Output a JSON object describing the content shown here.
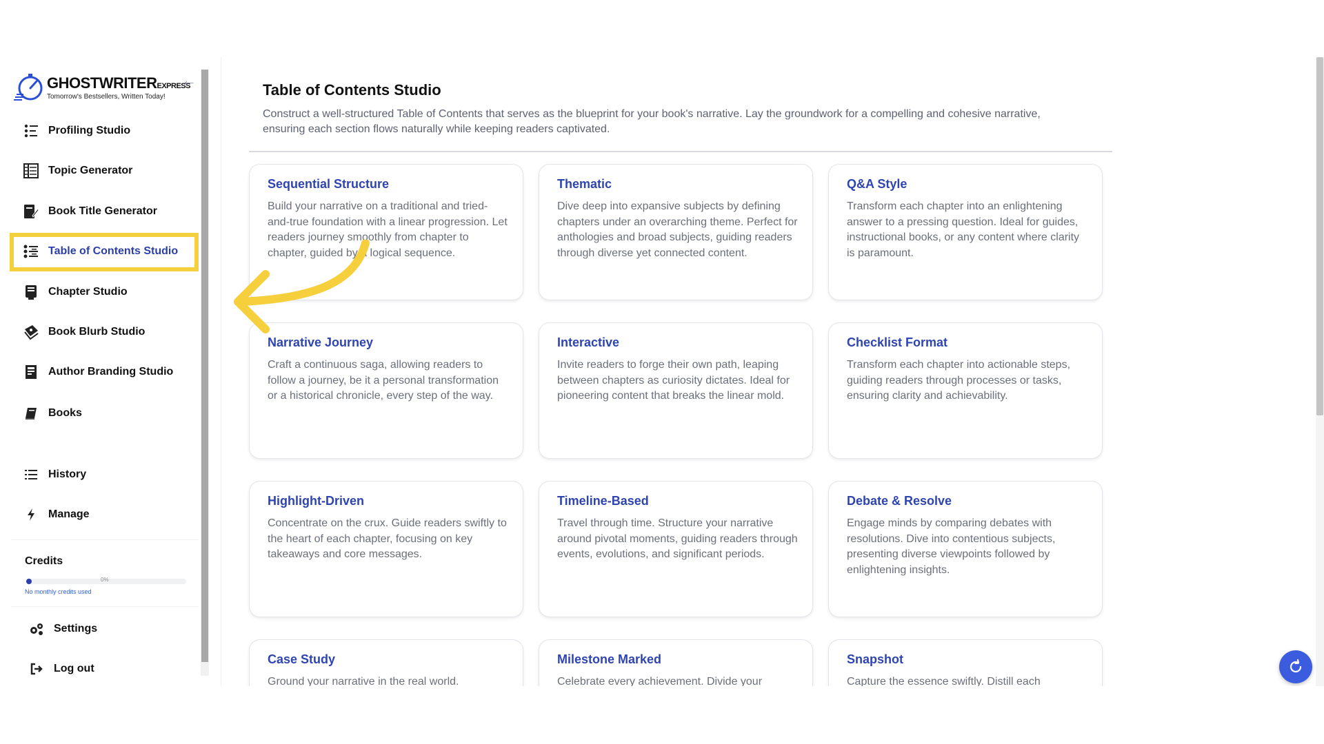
{
  "brand": {
    "name": "GHOSTWRITER",
    "suffix": "EXPRESS",
    "tagline": "Tomorrow's Bestsellers, Written Today!"
  },
  "sidebar": {
    "items": [
      {
        "label": "Profiling Studio",
        "icon": "profiling-list-icon",
        "active": false
      },
      {
        "label": "Topic Generator",
        "icon": "topic-grid-icon",
        "active": false
      },
      {
        "label": "Book Title Generator",
        "icon": "title-pen-icon",
        "active": false
      },
      {
        "label": "Table of Contents Studio",
        "icon": "toc-list-icon",
        "active": true
      },
      {
        "label": "Chapter Studio",
        "icon": "chapter-book-icon",
        "active": false
      },
      {
        "label": "Book Blurb Studio",
        "icon": "blurb-icon",
        "active": false
      },
      {
        "label": "Author Branding Studio",
        "icon": "branding-icon",
        "active": false
      },
      {
        "label": "Books",
        "icon": "book-icon",
        "active": false
      },
      {
        "label": "History",
        "icon": "history-list-icon",
        "active": false
      },
      {
        "label": "Manage",
        "icon": "lightning-icon",
        "active": false
      }
    ],
    "credits": {
      "title": "Credits",
      "percent_label": "0%",
      "used_fraction": 0.0,
      "subtitle": "No monthly credits used"
    },
    "settings_label": "Settings",
    "logout_label": "Log out"
  },
  "main": {
    "title": "Table of Contents Studio",
    "description": "Construct a well-structured Table of Contents that serves as the blueprint for your book's narrative. Lay the groundwork for a compelling and cohesive narrative, ensuring each section flows naturally while keeping readers captivated.",
    "cards": [
      {
        "title": "Sequential Structure",
        "desc": "Build your narrative on a traditional and tried-and-true foundation with a linear progression. Let readers journey smoothly from chapter to chapter, guided by a logical sequence."
      },
      {
        "title": "Thematic",
        "desc": "Dive deep into expansive subjects by defining chapters under an overarching theme. Perfect for anthologies and broad subjects, guiding readers through diverse yet connected content."
      },
      {
        "title": "Q&A Style",
        "desc": "Transform each chapter into an enlightening answer to a pressing question. Ideal for guides, instructional books, or any content where clarity is paramount."
      },
      {
        "title": "Narrative Journey",
        "desc": "Craft a continuous saga, allowing readers to follow a journey, be it a personal transformation or a historical chronicle, every step of the way."
      },
      {
        "title": "Interactive",
        "desc": "Invite readers to forge their own path, leaping between chapters as curiosity dictates. Ideal for pioneering content that breaks the linear mold."
      },
      {
        "title": "Checklist Format",
        "desc": "Transform each chapter into actionable steps, guiding readers through processes or tasks, ensuring clarity and achievability."
      },
      {
        "title": "Highlight-Driven",
        "desc": "Concentrate on the crux. Guide readers swiftly to the heart of each chapter, focusing on key takeaways and core messages."
      },
      {
        "title": "Timeline-Based",
        "desc": "Travel through time. Structure your narrative around pivotal moments, guiding readers through events, evolutions, and significant periods."
      },
      {
        "title": "Debate & Resolve",
        "desc": "Engage minds by comparing debates with resolutions. Dive into contentious subjects, presenting diverse viewpoints followed by enlightening insights."
      },
      {
        "title": "Case Study",
        "desc": "Ground your narrative in the real world."
      },
      {
        "title": "Milestone Marked",
        "desc": "Celebrate every achievement. Divide your"
      },
      {
        "title": "Snapshot",
        "desc": "Capture the essence swiftly. Distill each"
      }
    ]
  },
  "colors": {
    "accent": "#2e44b0",
    "highlight": "#f6cf3c",
    "fab": "#3c5ce0"
  }
}
